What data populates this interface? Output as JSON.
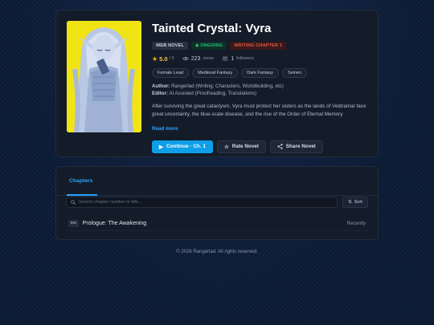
{
  "novel": {
    "title": "Tainted Crystal: Vyra",
    "badges": {
      "type": "WEB NOVEL",
      "status": "ONGOING",
      "progress": "WRITING CHAPTER 1"
    },
    "rating": "5.0",
    "rating_max": "/ 5",
    "views": "223",
    "views_label": "views",
    "followers": "1",
    "followers_label": "followers",
    "tags": [
      "Female Lead",
      "Medieval Fantasy",
      "Dark Fantasy",
      "Seinen"
    ],
    "author_label": "Author:",
    "author": "Rangerlad (Writing, Characters, Worldbuilding, etc)",
    "editor_label": "Editor:",
    "editor": "AI Assisted (Proofreading, Translations)",
    "synopsis": "After surviving the great cataclysm, Vyra must protect her sisters as the lands of Veldramar face great uncertainty, the blue-scale disease, and the rise of the Order of Eternal Memory",
    "read_more": "Read more",
    "actions": {
      "continue": "Continue · Ch. 1",
      "rate": "Rate Novel",
      "share": "Share Novel"
    }
  },
  "chapters": {
    "tab_label": "Chapters",
    "search_placeholder": "Search chapter number or title...",
    "sort_label": "Sort",
    "items": [
      {
        "lang": "EN",
        "title": "Prologue: The Awakening",
        "date": "Recently"
      }
    ]
  },
  "footer": "© 2026 Rangerlad. All rights reserved.",
  "colors": {
    "accent": "#0e9fe8",
    "ongoing": "#22c07a",
    "writing": "#e0574f",
    "rating": "#f4b400",
    "cover_bg": "#f1e414"
  },
  "icons": {
    "star": "star-icon",
    "views": "eye-icon",
    "followers": "users-icon",
    "continue": "play-icon",
    "rate": "star-outline-icon",
    "share": "share-icon",
    "search": "search-icon",
    "sort": "sort-icon"
  }
}
